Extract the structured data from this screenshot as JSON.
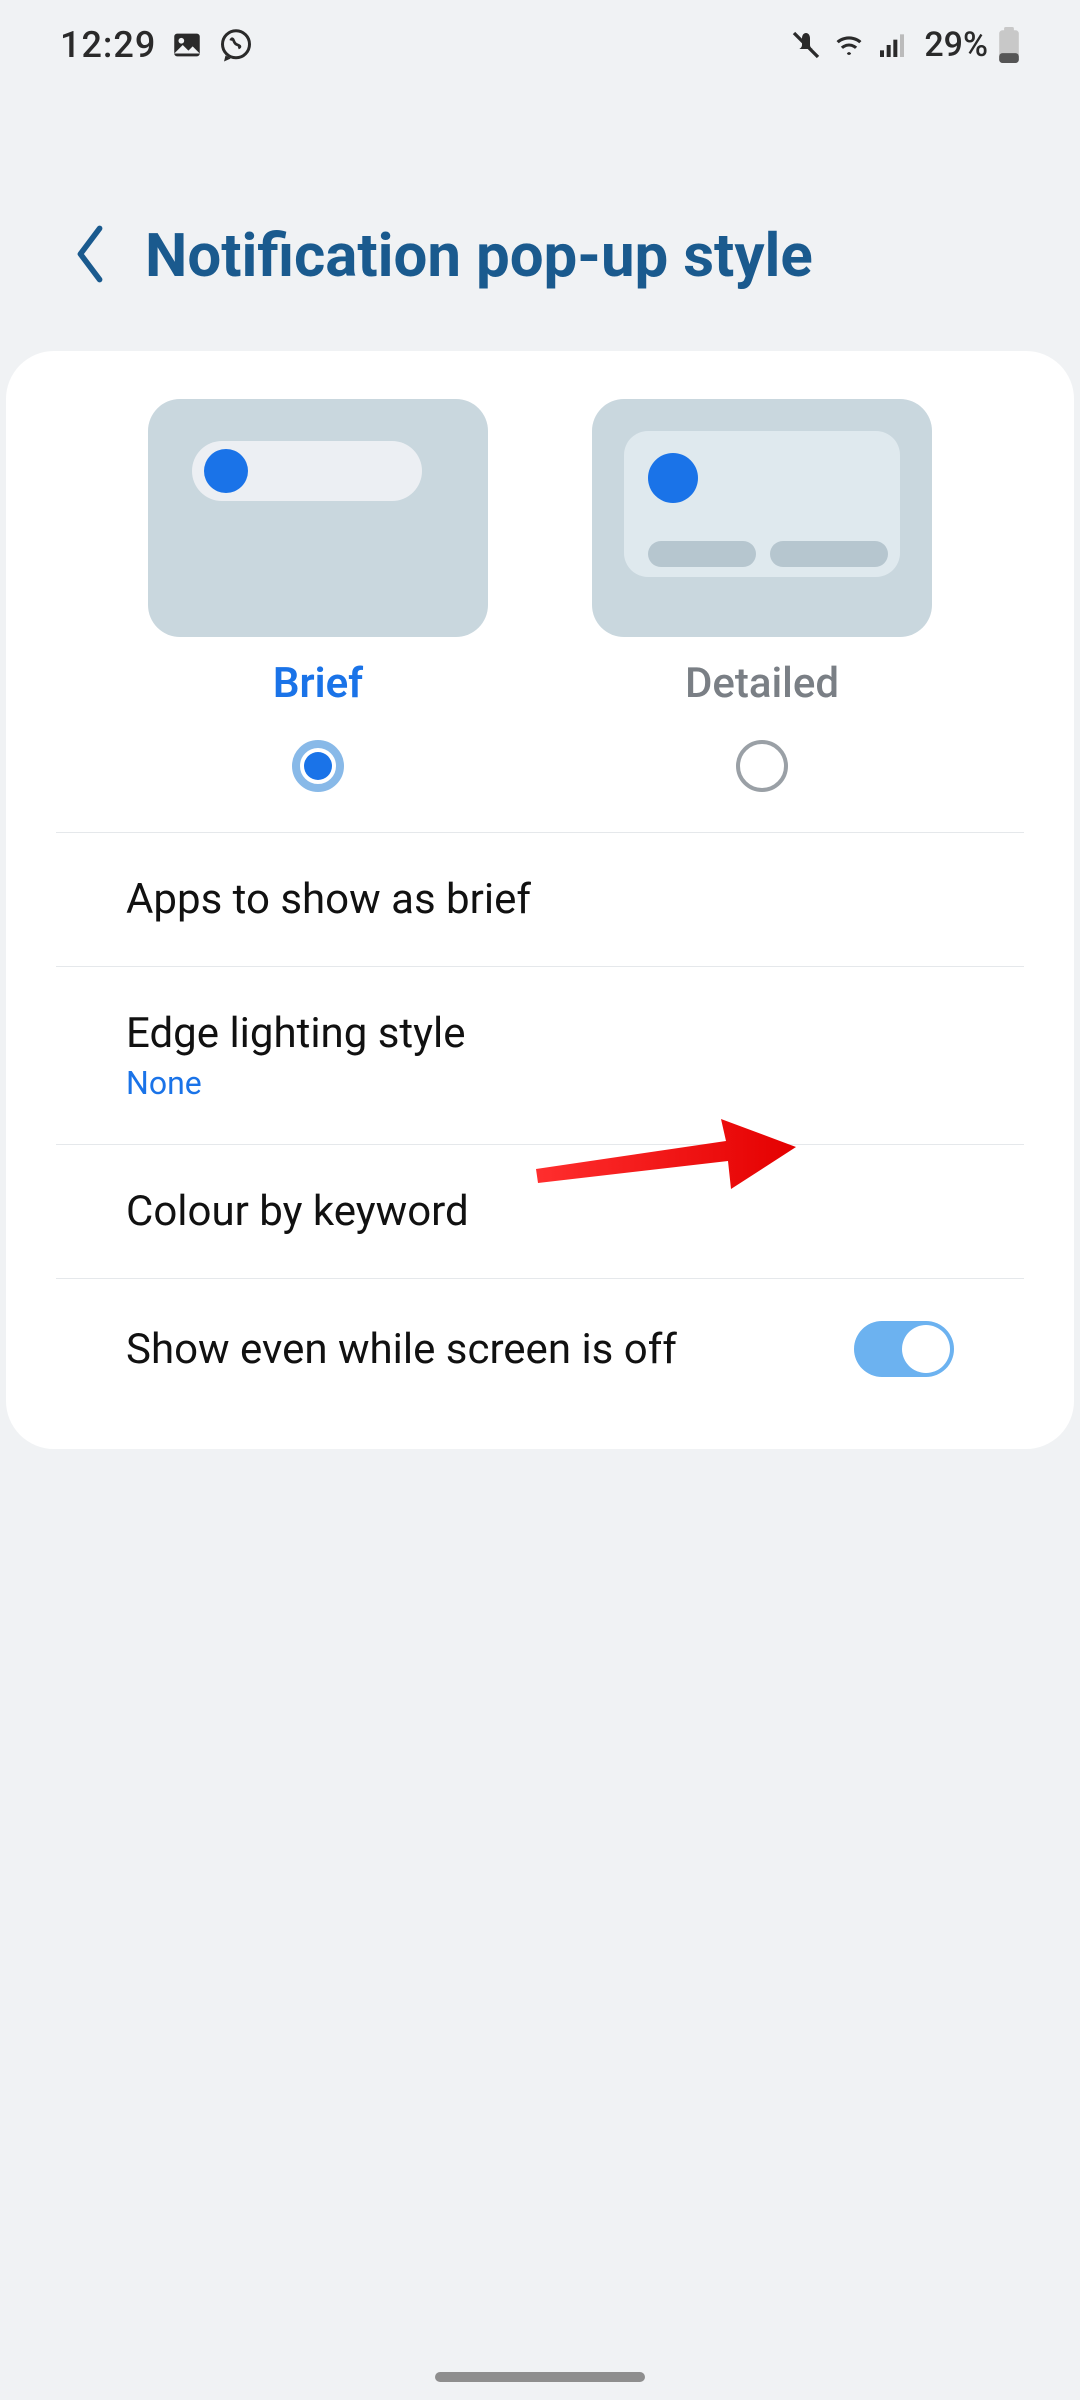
{
  "statusbar": {
    "time": "12:29",
    "battery_text": "29%"
  },
  "header": {
    "title": "Notification pop-up style"
  },
  "styles": {
    "brief_label": "Brief",
    "detailed_label": "Detailed",
    "selected": "brief"
  },
  "settings": {
    "apps_brief": {
      "title": "Apps to show as brief"
    },
    "edge_lighting": {
      "title": "Edge lighting style",
      "value": "None"
    },
    "colour_keyword": {
      "title": "Colour by keyword"
    },
    "show_screen_off": {
      "title": "Show even while screen is off",
      "toggled": true
    }
  }
}
